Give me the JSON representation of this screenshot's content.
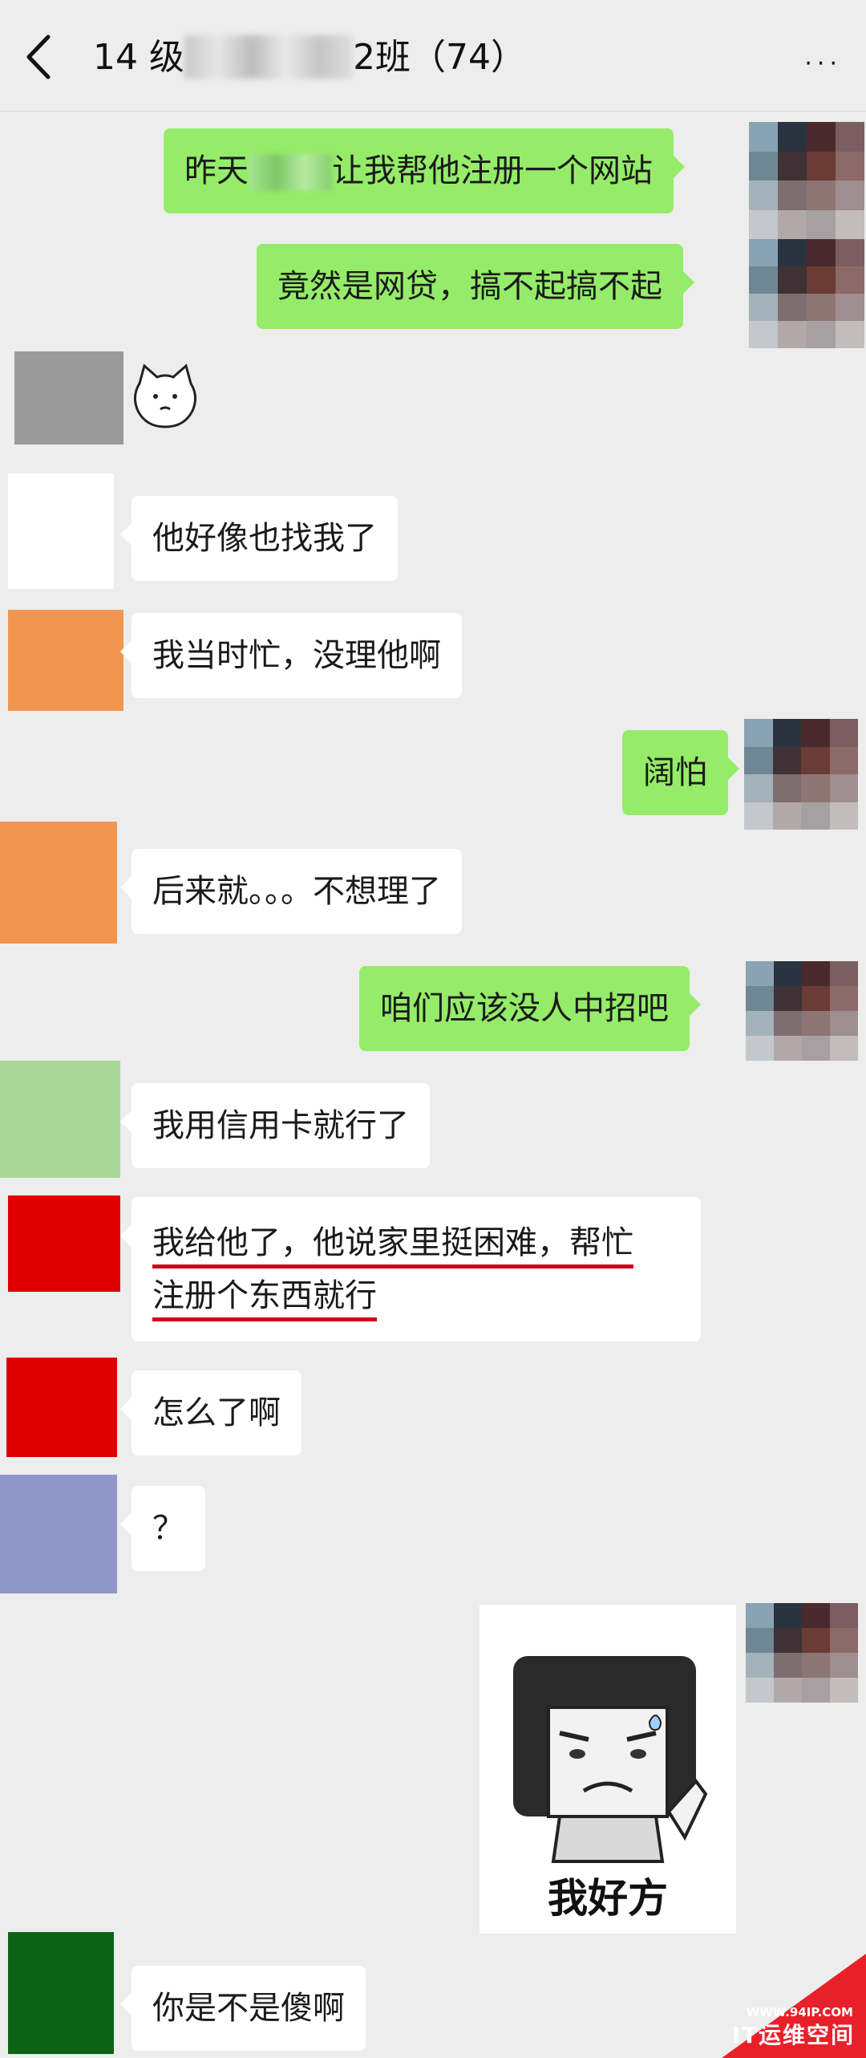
{
  "header": {
    "title_prefix": "14 级",
    "title_suffix": "2班（74）",
    "more": "···"
  },
  "messages": [
    {
      "side": "right",
      "text": "昨天",
      "text_after": "让我帮他注册一个网站"
    },
    {
      "side": "right",
      "text": "竟然是网贷，搞不起搞不起"
    },
    {
      "side": "left",
      "kind": "emoji"
    },
    {
      "side": "left",
      "text": "他好像也找我了"
    },
    {
      "side": "left",
      "text": "我当时忙，没理他啊"
    },
    {
      "side": "right",
      "text": "阔怕"
    },
    {
      "side": "left",
      "text": "后来就。。。不想理了"
    },
    {
      "side": "right",
      "text": "咱们应该没人中招吧"
    },
    {
      "side": "left",
      "text": "我用信用卡就行了"
    },
    {
      "side": "left",
      "line1": "我给他了，他说家里挺困难，帮忙",
      "line2": "注册个东西就行"
    },
    {
      "side": "left",
      "text": "怎么了啊"
    },
    {
      "side": "left",
      "text": "？"
    },
    {
      "side": "right",
      "kind": "sticker",
      "caption": "我好方"
    },
    {
      "side": "left",
      "text": "你是不是傻啊"
    }
  ],
  "avatar_colors": {
    "gray": "#9a9a9a",
    "white": "#ffffff",
    "orange": "#f2954f",
    "light_green": "#a8d796",
    "red": "#e00000",
    "periwinkle": "#8f98c9",
    "dark_green": "#0c6316"
  },
  "accent": {
    "bubble_green": "#95ec69",
    "underline_red": "#d0021b"
  },
  "watermark": {
    "url": "WWW.94IP.COM",
    "name": "IT运维空间"
  }
}
